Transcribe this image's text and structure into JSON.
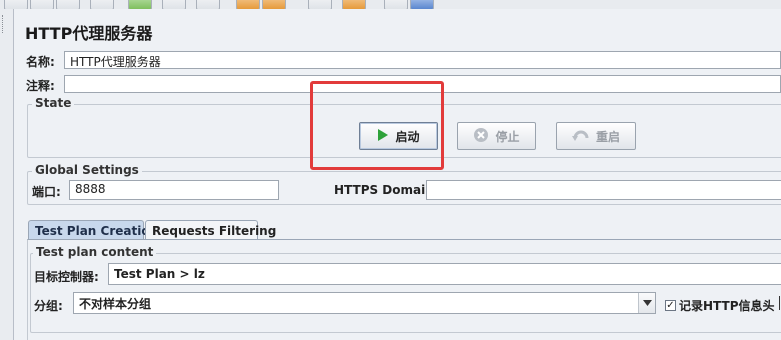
{
  "panel": {
    "title": "HTTP代理服务器"
  },
  "fields": {
    "name_label": "名称:",
    "name_value": "HTTP代理服务器",
    "comment_label": "注释:",
    "comment_value": ""
  },
  "state": {
    "group_title": "State",
    "start_label": "启动",
    "stop_label": "停止",
    "restart_label": "重启"
  },
  "global": {
    "group_title": "Global Settings",
    "port_label": "端口:",
    "port_value": "8888",
    "https_label": "HTTPS Domains:",
    "https_value": ""
  },
  "tabs": [
    {
      "label": "Test Plan Creation",
      "active": true
    },
    {
      "label": "Requests Filtering",
      "active": false
    }
  ],
  "content": {
    "group_title": "Test plan content",
    "target_label": "目标控制器:",
    "target_value": "Test Plan > lz",
    "group_label": "分组:",
    "group_value": "不对样本分组",
    "record_http_label": "记录HTTP信息头",
    "record_http_checked": true
  },
  "colors": {
    "highlight_border": "#e23b3b",
    "active_tab": "#c8d8ec",
    "play_icon": "#2ea23a"
  }
}
